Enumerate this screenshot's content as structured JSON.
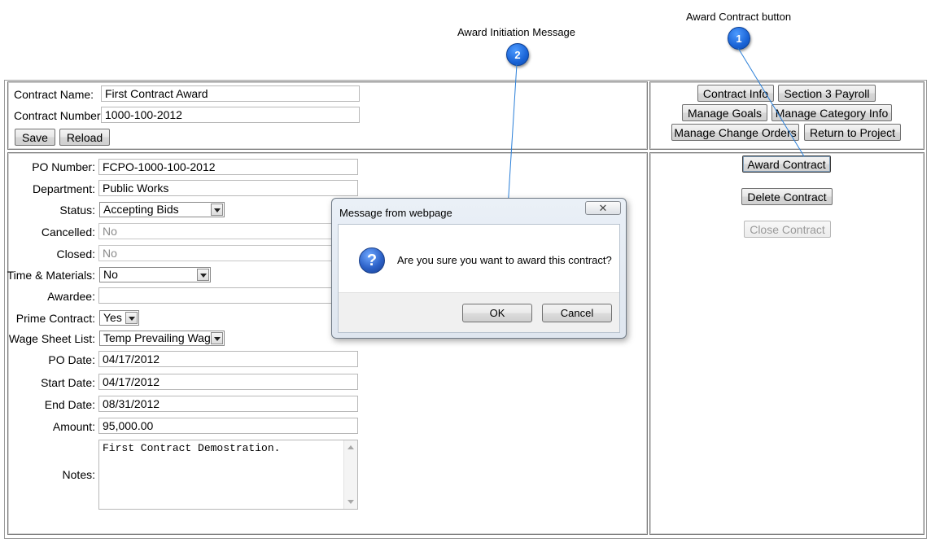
{
  "callouts": [
    {
      "number": "1",
      "label": "Award Contract button"
    },
    {
      "number": "2",
      "label": "Award Initiation Message"
    }
  ],
  "header_form": {
    "contract_name_label": "Contract Name:",
    "contract_name_value": "First Contract Award",
    "contract_number_label": "Contract Number:",
    "contract_number_value": "1000-100-2012",
    "save_label": "Save",
    "reload_label": "Reload"
  },
  "nav_buttons": {
    "contract_info": "Contract Info",
    "section3_payroll": "Section 3 Payroll",
    "manage_goals": "Manage Goals",
    "manage_category_info": "Manage Category Info",
    "manage_change_orders": "Manage Change Orders",
    "return_to_project": "Return to Project"
  },
  "details": {
    "po_number_label": "PO Number:",
    "po_number_value": "FCPO-1000-100-2012",
    "department_label": "Department:",
    "department_value": "Public Works",
    "status_label": "Status:",
    "status_value": "Accepting Bids",
    "cancelled_label": "Cancelled:",
    "cancelled_value": "No",
    "closed_label": "Closed:",
    "closed_value": "No",
    "time_materials_label": "Time & Materials:",
    "time_materials_value": "No",
    "awardee_label": "Awardee:",
    "awardee_value": "",
    "prime_contract_label": "Prime Contract:",
    "prime_contract_value": "Yes",
    "wage_sheet_label": "Wage Sheet List:",
    "wage_sheet_value": "Temp Prevailing Wage",
    "po_date_label": "PO Date:",
    "po_date_value": "04/17/2012",
    "start_date_label": "Start Date:",
    "start_date_value": "04/17/2012",
    "end_date_label": "End Date:",
    "end_date_value": "08/31/2012",
    "amount_label": "Amount:",
    "amount_value": "95,000.00",
    "notes_label": "Notes:",
    "notes_value": "First Contract Demostration."
  },
  "actions": {
    "award_contract": "Award Contract",
    "delete_contract": "Delete Contract",
    "close_contract": "Close Contract"
  },
  "dialog": {
    "title": "Message from webpage",
    "close_glyph": "✕",
    "icon_glyph": "?",
    "message": "Are you sure you want to award this contract?",
    "ok_label": "OK",
    "cancel_label": "Cancel"
  }
}
